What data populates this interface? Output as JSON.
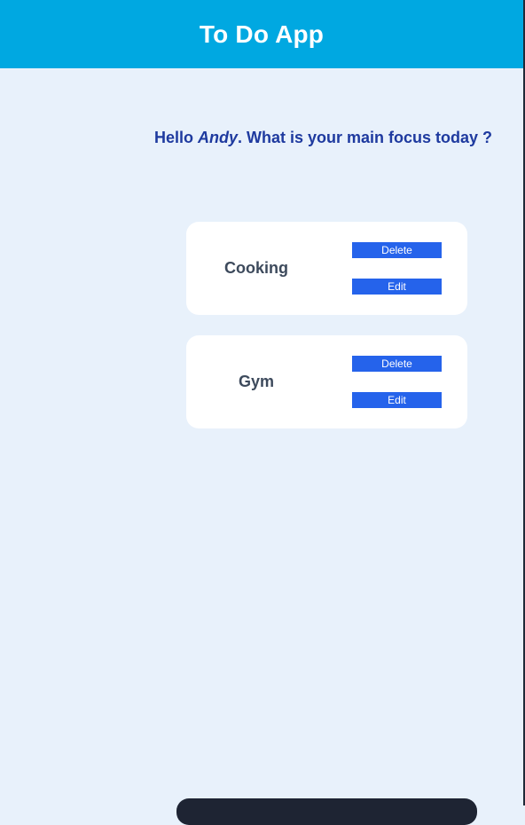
{
  "header": {
    "title": "To Do App"
  },
  "greeting": {
    "prefix": "Hello ",
    "name": "Andy",
    "suffix": ". What is your main focus today ?"
  },
  "tasks": [
    {
      "title": "Cooking",
      "delete_label": "Delete",
      "edit_label": "Edit"
    },
    {
      "title": "Gym",
      "delete_label": "Delete",
      "edit_label": "Edit"
    }
  ],
  "colors": {
    "header_bg": "#00a8e1",
    "page_bg": "#e8f1fb",
    "greeting_text": "#1e3a9f",
    "button_bg": "#2563eb",
    "card_bg": "#ffffff",
    "task_text": "#3d4a5c"
  }
}
